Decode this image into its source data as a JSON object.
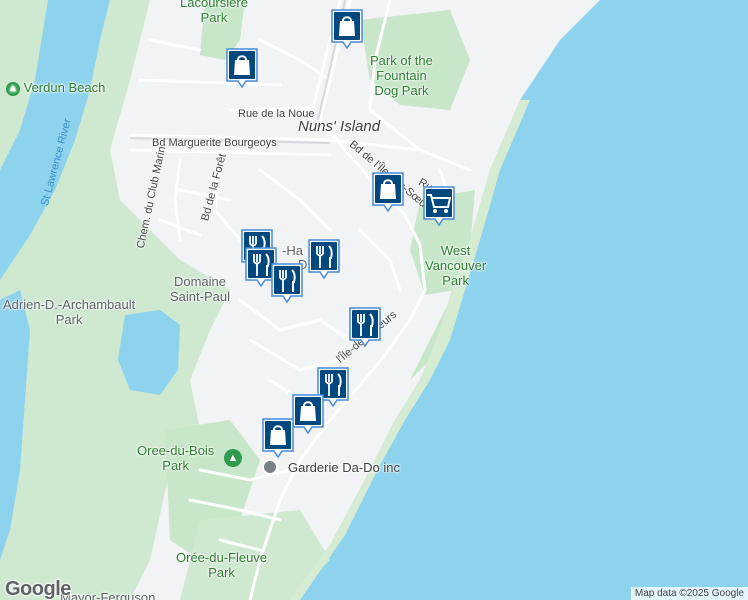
{
  "map": {
    "labels": {
      "lacoursiere": "Lacoursière\nPark",
      "park_fountain": "Park of the\nFountain\nDog Park",
      "verdun_beach": "Verdun Beach",
      "st_lawrence": "St Lawrence River",
      "rue_noue": "Rue de la Noue",
      "nuns_island": "Nuns' Island",
      "bd_marguerite": "Bd Marguerite Bourgeoys",
      "bd_ile_des_soeurs_n": "Bd de l'Île-des-Sœurs",
      "ru": "Ru",
      "chem_club_marin": "Chem. du Club Marin",
      "bd_foret": "Bd de la Forêt",
      "west_vancouver": "West\nVancouver\nPark",
      "domaine": "Domaine\nSaint-Paul",
      "adrien": "Adrien-D.-Archambault\nPark",
      "ile_des_soeurs_s": "l'Île-des-Sœurs",
      "oree_bois": "Oree-du-Bois\nPark",
      "garderie": "Garderie Da-Do inc",
      "oree_fleuve": "Orée-du-Fleuve\nPark",
      "mayor_ferguson": "Mayor-Ferguson",
      "ha_fragment": "-Ha",
      "d_fragment": "D"
    },
    "markers": [
      {
        "name": "shopping-marker-1",
        "icon": "shopping-bag-icon"
      },
      {
        "name": "shopping-marker-2",
        "icon": "shopping-bag-icon"
      },
      {
        "name": "shopping-marker-3",
        "icon": "shopping-bag-icon"
      },
      {
        "name": "grocery-marker-1",
        "icon": "shopping-cart-icon"
      },
      {
        "name": "restaurant-marker-1",
        "icon": "restaurant-icon"
      },
      {
        "name": "restaurant-marker-2",
        "icon": "restaurant-icon"
      },
      {
        "name": "restaurant-marker-3",
        "icon": "restaurant-icon"
      },
      {
        "name": "restaurant-marker-4",
        "icon": "restaurant-icon"
      },
      {
        "name": "restaurant-marker-5",
        "icon": "restaurant-icon"
      },
      {
        "name": "restaurant-marker-6",
        "icon": "restaurant-icon"
      },
      {
        "name": "shopping-marker-4",
        "icon": "shopping-bag-icon"
      },
      {
        "name": "shopping-marker-5",
        "icon": "shopping-bag-icon"
      }
    ],
    "colors": {
      "water": "#8ed3ee",
      "land": "#f1f3f4",
      "park": "#c8e6c9",
      "marker_fill": "#01487e",
      "marker_border": "#4a8ad8"
    },
    "logo_text": "Google",
    "attribution": "Map data ©2025 Google"
  }
}
